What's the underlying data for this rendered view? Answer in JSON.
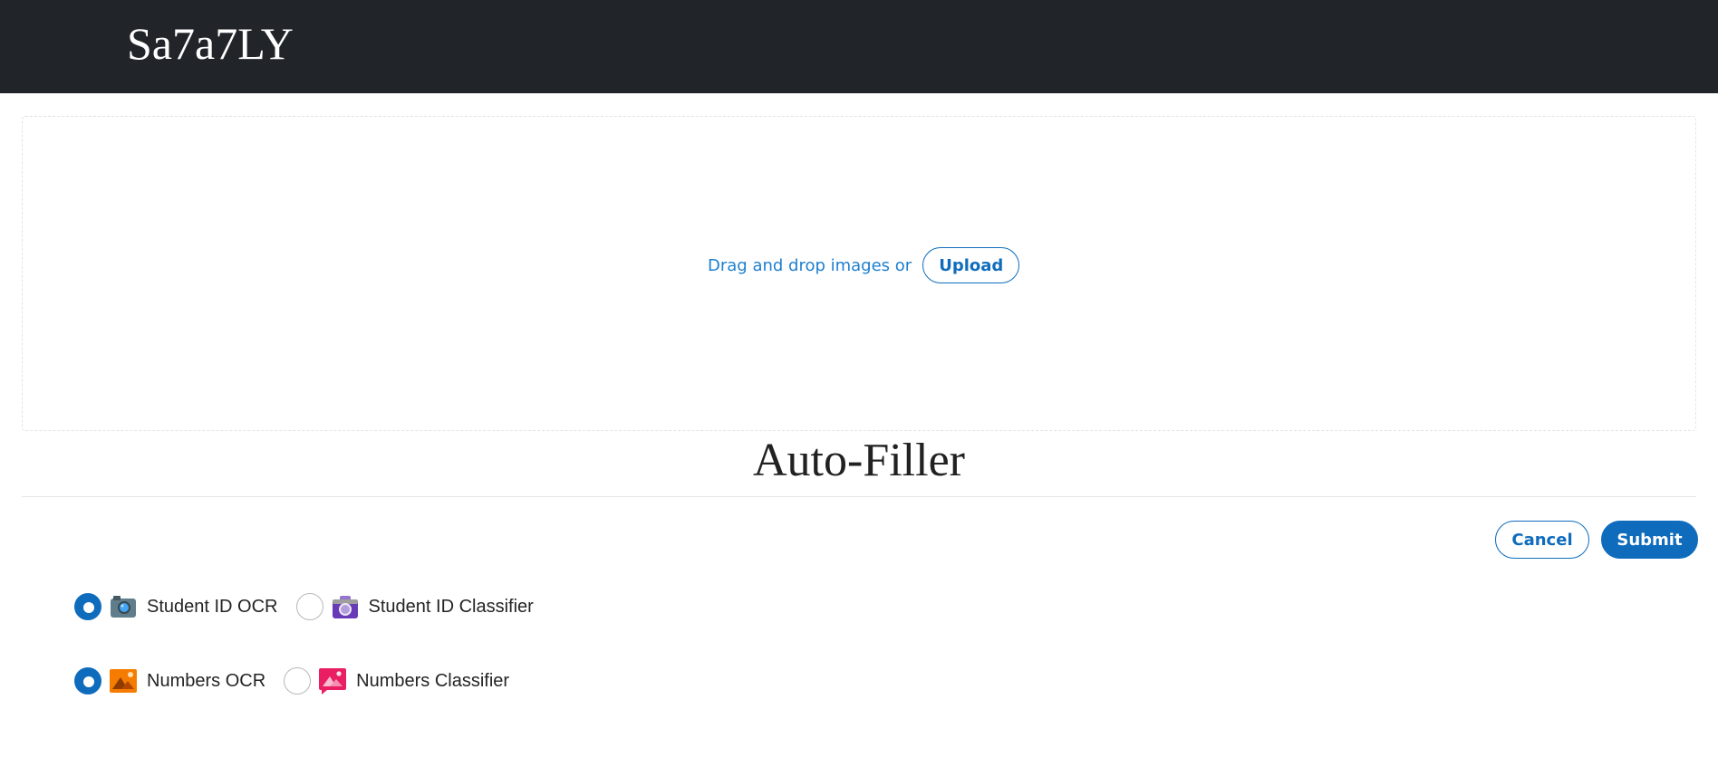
{
  "header": {
    "brand": "Sa7a7LY",
    "background_color": "#212529"
  },
  "upload": {
    "prompt": "Drag and drop images or",
    "button_label": "Upload"
  },
  "page_title": "Auto-Filler",
  "actions": {
    "cancel_label": "Cancel",
    "submit_label": "Submit"
  },
  "options": {
    "student_id": [
      {
        "label": "Student ID OCR",
        "icon": "camera-icon",
        "checked": true
      },
      {
        "label": "Student ID Classifier",
        "icon": "camera-purple-icon",
        "checked": false
      }
    ],
    "numbers": [
      {
        "label": "Numbers OCR",
        "icon": "image-orange-icon",
        "checked": true
      },
      {
        "label": "Numbers Classifier",
        "icon": "image-pink-icon",
        "checked": false
      }
    ]
  },
  "colors": {
    "accent": "#0f6cbd",
    "prompt_text": "#1e7fd0"
  }
}
